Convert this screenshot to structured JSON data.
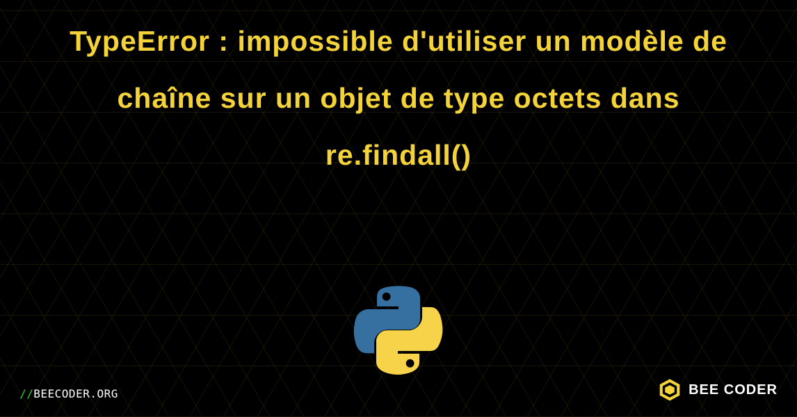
{
  "title": "TypeError : impossible d'utiliser un modèle de chaîne sur un objet de type octets dans re.findall()",
  "footer": {
    "url_prefix": "//",
    "url_text": "BEECODER.ORG",
    "brand_text": "BEE CODER"
  },
  "icons": {
    "python_logo": "python-logo-icon",
    "brand_hex": "hexagon-icon"
  },
  "colors": {
    "background": "#000000",
    "accent": "#f4d33a",
    "brand_hex_fill": "#f4d33a",
    "url_slash": "#34b233",
    "python_blue": "#3670a0",
    "python_yellow": "#f6d349"
  }
}
